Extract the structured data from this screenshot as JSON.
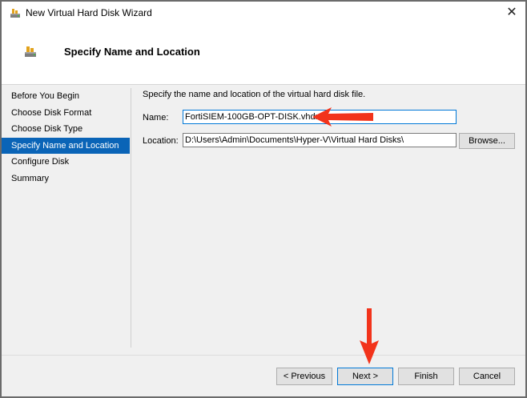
{
  "window": {
    "title": "New Virtual Hard Disk Wizard",
    "close_glyph": "✕"
  },
  "header": {
    "title": "Specify Name and Location"
  },
  "nav": {
    "items": [
      {
        "label": "Before You Begin",
        "active": false
      },
      {
        "label": "Choose Disk Format",
        "active": false
      },
      {
        "label": "Choose Disk Type",
        "active": false
      },
      {
        "label": "Specify Name and Location",
        "active": true
      },
      {
        "label": "Configure Disk",
        "active": false
      },
      {
        "label": "Summary",
        "active": false
      }
    ]
  },
  "content": {
    "description": "Specify the name and location of the virtual hard disk file.",
    "name_label": "Name:",
    "name_value": "FortiSIEM-100GB-OPT-DISK.vhdx",
    "location_label": "Location:",
    "location_value": "D:\\Users\\Admin\\Documents\\Hyper-V\\Virtual Hard Disks\\",
    "browse_label": "Browse..."
  },
  "footer": {
    "previous_label": "< Previous",
    "next_label": "Next >",
    "finish_label": "Finish",
    "cancel_label": "Cancel"
  },
  "colors": {
    "accent": "#0a64b7",
    "annotation_arrow": "#f2331b"
  }
}
